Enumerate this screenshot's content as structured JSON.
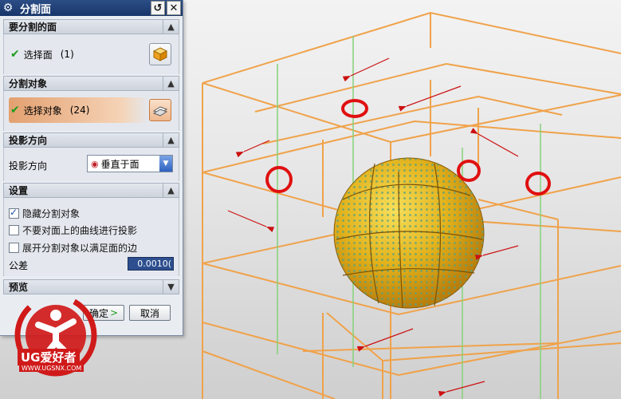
{
  "dialog": {
    "title": "分割面",
    "title_icons": [
      "gear-icon",
      "reset-icon",
      "close-icon"
    ],
    "sections": {
      "face_to_split": {
        "header": "要分割的面",
        "select_label": "选择面",
        "select_count": "(1)",
        "icon": "face-select-cube-icon"
      },
      "split_objects": {
        "header": "分割对象",
        "select_label": "选择对象",
        "select_count": "(24)",
        "icon": "object-select-sheet-icon"
      },
      "projection": {
        "header": "投影方向",
        "field_label": "投影方向",
        "selected_option": "垂直于面"
      },
      "settings": {
        "header": "设置",
        "options": [
          {
            "label": "隐藏分割对象",
            "checked": true
          },
          {
            "label": "不要对面上的曲线进行投影",
            "checked": false
          },
          {
            "label": "展开分割对象以满足面的边",
            "checked": false
          }
        ],
        "tolerance_label": "公差",
        "tolerance_value": "0.0010("
      },
      "preview": {
        "header": "预览"
      }
    },
    "ok_label": "确定",
    "ok_arrow": ">",
    "cancel_label": "取消"
  },
  "watermark": {
    "brand": "UG爱好者",
    "url": "WWW.UGSNX.COM"
  },
  "colors": {
    "grid_lines": "#f0a24a",
    "sphere": "#e2b21c",
    "annotation_red": "#e01010",
    "title_bar": "#1e3f78",
    "check_green": "#1c9d1c"
  }
}
